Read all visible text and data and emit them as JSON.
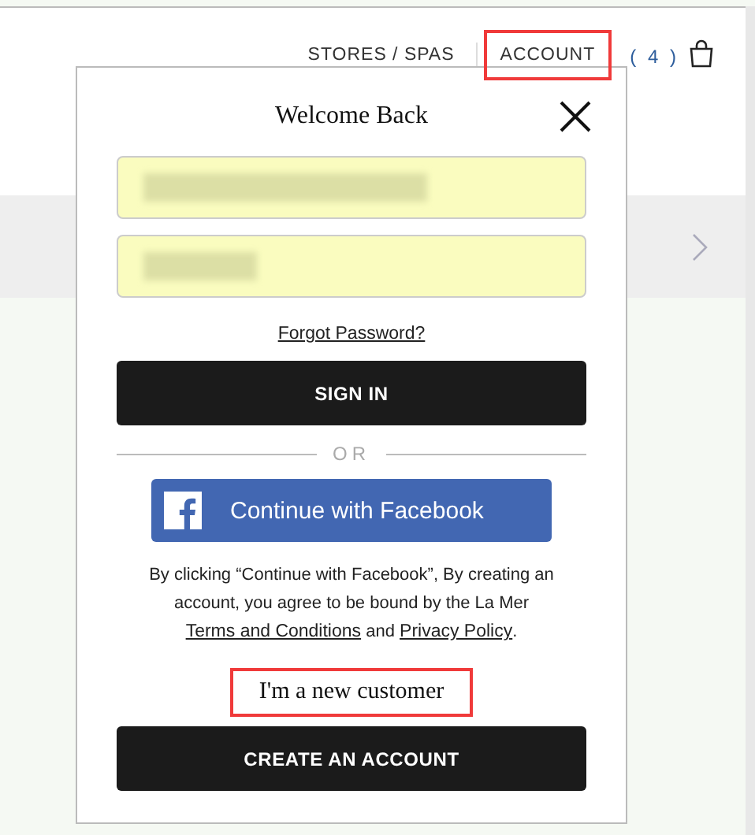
{
  "header": {
    "nav": [
      {
        "label": "STORES / SPAS",
        "highlighted": false
      },
      {
        "label": "ACCOUNT",
        "highlighted": true
      }
    ],
    "cart_count": "( 4 )"
  },
  "modal": {
    "title": "Welcome Back",
    "fields": [
      {
        "kind": "email",
        "redacted": true
      },
      {
        "kind": "password",
        "redacted": true
      }
    ],
    "forgot_link": "Forgot Password?",
    "sign_in_button": "SIGN IN",
    "divider": "OR",
    "facebook_button": "Continue with Facebook",
    "legal": {
      "text": "By clicking “Continue with Facebook”, By creating an account, you agree to be bound by the La Mer",
      "terms_link": "Terms and Conditions",
      "joiner": "and",
      "privacy_link": "Privacy Policy",
      "end": "."
    },
    "new_customer": {
      "label": "I'm a new customer",
      "highlighted": true
    },
    "create_button": "CREATE AN ACCOUNT"
  }
}
